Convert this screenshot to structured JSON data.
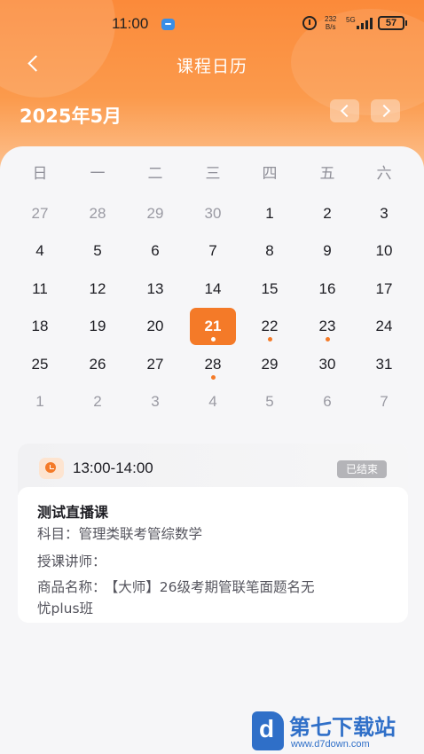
{
  "status_bar": {
    "time": "11:00",
    "net_speed_value": "232",
    "net_speed_unit": "B/s",
    "network": "5G",
    "battery": "57"
  },
  "header": {
    "title": "课程日历",
    "month": "2025年5月"
  },
  "calendar": {
    "weekdays": [
      "日",
      "一",
      "二",
      "三",
      "四",
      "五",
      "六"
    ],
    "weeks": [
      [
        {
          "d": "27",
          "other": true
        },
        {
          "d": "28",
          "other": true
        },
        {
          "d": "29",
          "other": true
        },
        {
          "d": "30",
          "other": true
        },
        {
          "d": "1"
        },
        {
          "d": "2"
        },
        {
          "d": "3"
        }
      ],
      [
        {
          "d": "4"
        },
        {
          "d": "5"
        },
        {
          "d": "6"
        },
        {
          "d": "7"
        },
        {
          "d": "8"
        },
        {
          "d": "9"
        },
        {
          "d": "10"
        }
      ],
      [
        {
          "d": "11"
        },
        {
          "d": "12"
        },
        {
          "d": "13"
        },
        {
          "d": "14"
        },
        {
          "d": "15"
        },
        {
          "d": "16"
        },
        {
          "d": "17"
        }
      ],
      [
        {
          "d": "18"
        },
        {
          "d": "19"
        },
        {
          "d": "20"
        },
        {
          "d": "21",
          "selected": true,
          "dot": true
        },
        {
          "d": "22",
          "dot": true
        },
        {
          "d": "23",
          "dot": true
        },
        {
          "d": "24"
        }
      ],
      [
        {
          "d": "25"
        },
        {
          "d": "26"
        },
        {
          "d": "27"
        },
        {
          "d": "28",
          "dot": true
        },
        {
          "d": "29"
        },
        {
          "d": "30"
        },
        {
          "d": "31"
        }
      ],
      [
        {
          "d": "1",
          "other": true
        },
        {
          "d": "2",
          "other": true
        },
        {
          "d": "3",
          "other": true
        },
        {
          "d": "4",
          "other": true
        },
        {
          "d": "5",
          "other": true
        },
        {
          "d": "6",
          "other": true
        },
        {
          "d": "7",
          "other": true
        }
      ]
    ],
    "accent_color": "#f47a28"
  },
  "lesson": {
    "time": "13:00-14:00",
    "status": "已结束",
    "name": "测试直播课",
    "subject_label": "科目：",
    "subject": "管理类联考管综数学",
    "teacher_label": "授课讲师：",
    "teacher": "",
    "product_label": "商品名称：",
    "product_line1": "【大师】26级考期管联笔面题名无",
    "product_line2": "忧plus班"
  },
  "watermark": {
    "name": "第七下载站",
    "url": "www.d7down.com"
  }
}
